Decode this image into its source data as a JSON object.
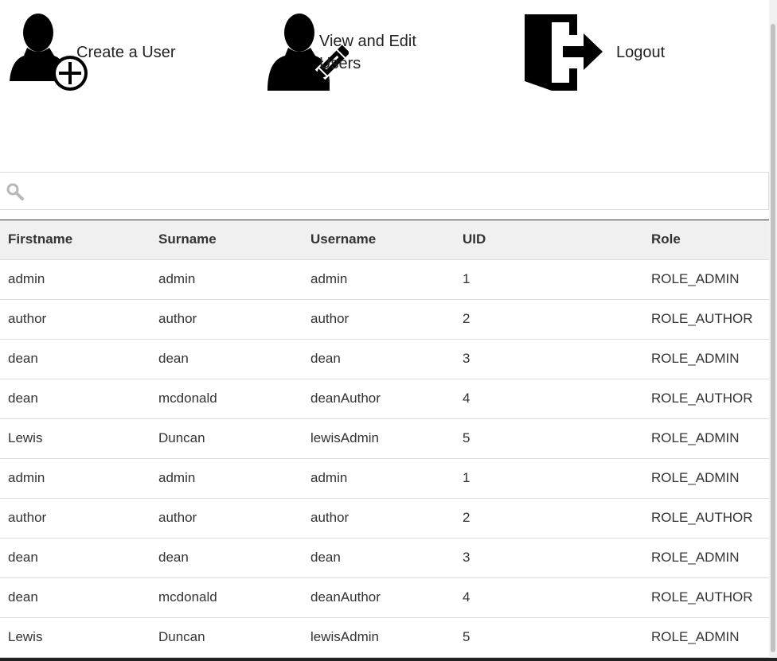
{
  "menu": {
    "create_user": "Create a User",
    "view_edit_users": "View and Edit Users",
    "logout": "Logout"
  },
  "search": {
    "placeholder": "",
    "value": ""
  },
  "table": {
    "headers": [
      "Firstname",
      "Surname",
      "Username",
      "UID",
      "Role"
    ],
    "rows": [
      [
        "admin",
        "admin",
        "admin",
        "1",
        "ROLE_ADMIN"
      ],
      [
        "author",
        "author",
        "author",
        "2",
        "ROLE_AUTHOR"
      ],
      [
        "dean",
        "dean",
        "dean",
        "3",
        "ROLE_ADMIN"
      ],
      [
        "dean",
        "mcdonald",
        "deanAuthor",
        "4",
        "ROLE_AUTHOR"
      ],
      [
        "Lewis",
        "Duncan",
        "lewisAdmin",
        "5",
        "ROLE_ADMIN"
      ],
      [
        "admin",
        "admin",
        "admin",
        "1",
        "ROLE_ADMIN"
      ],
      [
        "author",
        "author",
        "author",
        "2",
        "ROLE_AUTHOR"
      ],
      [
        "dean",
        "dean",
        "dean",
        "3",
        "ROLE_ADMIN"
      ],
      [
        "dean",
        "mcdonald",
        "deanAuthor",
        "4",
        "ROLE_AUTHOR"
      ],
      [
        "Lewis",
        "Duncan",
        "lewisAdmin",
        "5",
        "ROLE_ADMIN"
      ]
    ]
  },
  "icons": {
    "create_user": "add-user-icon",
    "view_edit_users": "edit-user-icon",
    "logout": "logout-icon",
    "search": "search-icon"
  }
}
